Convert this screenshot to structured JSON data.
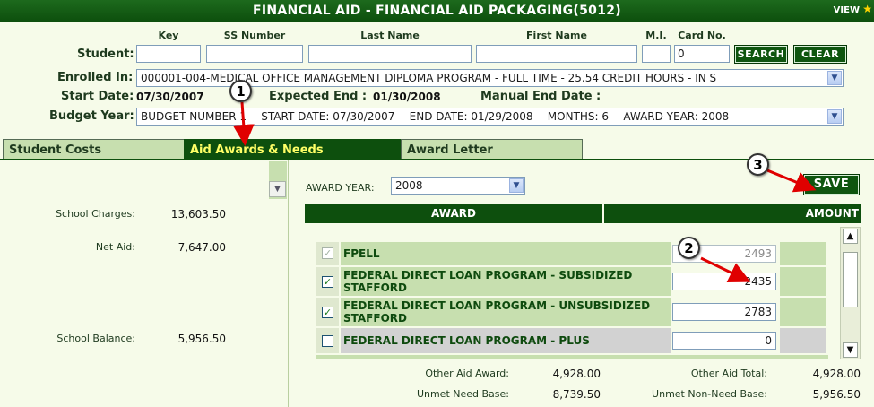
{
  "window": {
    "title": "FINANCIAL AID - FINANCIAL AID PACKAGING(5012)",
    "view_label": "VIEW"
  },
  "search": {
    "student_label": "Student:",
    "headers": {
      "key": "Key",
      "ss_number": "SS Number",
      "last_name": "Last Name",
      "first_name": "First Name",
      "mi": "M.I.",
      "card_no": "Card No."
    },
    "values": {
      "key": "",
      "ss_number": "",
      "last_name": "",
      "first_name": "",
      "mi": "",
      "card_no": "0"
    },
    "search_button": "SEARCH",
    "clear_button": "CLEAR"
  },
  "enrollment": {
    "enrolled_label": "Enrolled In:",
    "enrolled_value": "000001-004-MEDICAL OFFICE MANAGEMENT DIPLOMA PROGRAM - FULL TIME - 25.54 CREDIT HOURS - IN S",
    "start_label": "Start Date:",
    "start_value": "07/30/2007",
    "expected_label": "Expected End :",
    "expected_value": "01/30/2008",
    "manual_label": "Manual End Date :",
    "budget_label": "Budget Year:",
    "budget_value": "BUDGET NUMBER 1 -- START DATE: 07/30/2007 -- END DATE: 01/29/2008 -- MONTHS: 6 -- AWARD YEAR: 2008"
  },
  "tabs": {
    "student_costs": "Student Costs",
    "aid_awards": "Aid Awards & Needs",
    "award_letter": "Award Letter"
  },
  "summary": {
    "school_charges_label": "School Charges:",
    "school_charges": "13,603.50",
    "net_aid_label": "Net Aid:",
    "net_aid": "7,647.00",
    "school_balance_label": "School Balance:",
    "school_balance": "5,956.50"
  },
  "award": {
    "year_label": "AWARD YEAR:",
    "year_value": "2008",
    "save_button": "SAVE",
    "col_award": "AWARD",
    "col_amount": "AMOUNT",
    "rows": [
      {
        "name": "FPELL",
        "amount": "2493",
        "checked": true,
        "disabled": true
      },
      {
        "name": "FEDERAL DIRECT LOAN PROGRAM - SUBSIDIZED STAFFORD",
        "amount": "2435",
        "checked": true,
        "disabled": false
      },
      {
        "name": "FEDERAL DIRECT LOAN PROGRAM - UNSUBSIDIZED STAFFORD",
        "amount": "2783",
        "checked": true,
        "disabled": false
      },
      {
        "name": "FEDERAL DIRECT LOAN PROGRAM - PLUS",
        "amount": "0",
        "checked": false,
        "disabled": false
      }
    ],
    "scroll_position": 0.15
  },
  "totals": {
    "other_aid_award_label": "Other Aid Award:",
    "other_aid_award": "4,928.00",
    "other_aid_total_label": "Other Aid Total:",
    "other_aid_total": "4,928.00",
    "unmet_need_base_label": "Unmet Need Base:",
    "unmet_need_base": "8,739.50",
    "unmet_non_need_label": "Unmet Non-Need Base:",
    "unmet_non_need": "5,956.50"
  },
  "callouts": [
    "1",
    "2",
    "3"
  ],
  "icons": [
    "dropdown-arrow-icon",
    "checkbox-icon",
    "scroll-up-icon",
    "scroll-down-icon",
    "star-icon"
  ],
  "colors": {
    "brand_green": "#0d4f0d",
    "active_tab": "#0d4f0d",
    "active_tab_text": "#ffff66",
    "background": "#f6fbe9",
    "row_bg": "#c7dfaf",
    "callout_arrow": "#e00000"
  }
}
